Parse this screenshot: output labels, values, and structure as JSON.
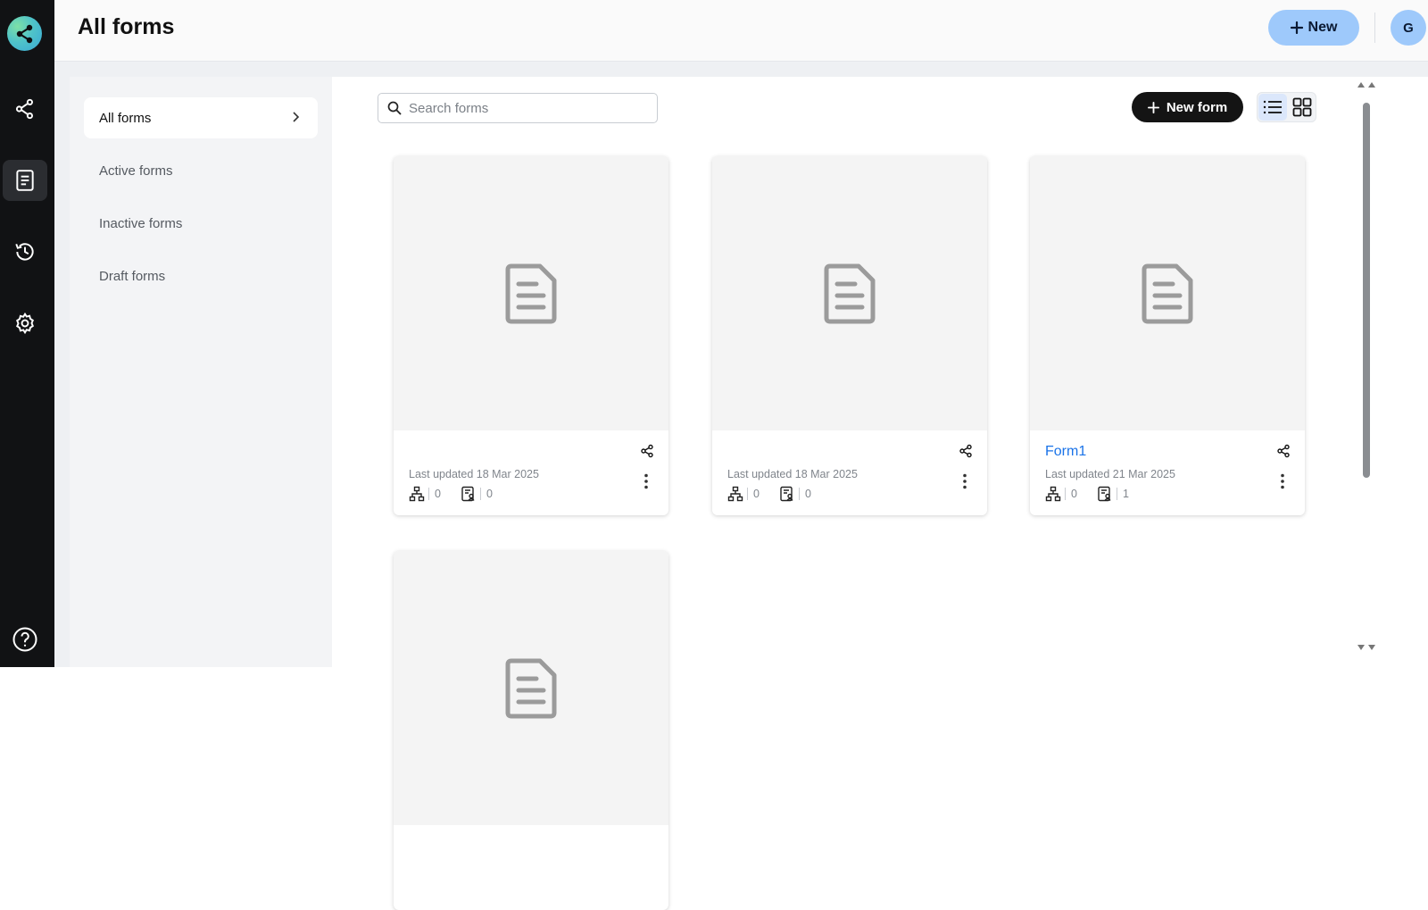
{
  "header": {
    "title": "All forms",
    "new_button": "New",
    "avatar_initial": "G"
  },
  "rail": {
    "items": [
      "workflows-icon",
      "forms-icon",
      "history-icon",
      "settings-icon",
      "help-icon"
    ],
    "active": "forms-icon"
  },
  "subnav": {
    "items": [
      {
        "label": "All forms",
        "active": true
      },
      {
        "label": "Active forms",
        "active": false
      },
      {
        "label": "Inactive forms",
        "active": false
      },
      {
        "label": "Draft forms",
        "active": false
      }
    ]
  },
  "toolbar": {
    "search_placeholder": "Search forms",
    "new_form_label": "New form",
    "view_modes": [
      "list",
      "grid"
    ],
    "active_view": "grid"
  },
  "cards": [
    {
      "name": "",
      "updated": "Last updated 18 Mar 2025",
      "workflows": "0",
      "responses": "0"
    },
    {
      "name": "",
      "updated": "Last updated 18 Mar 2025",
      "workflows": "0",
      "responses": "0"
    },
    {
      "name": "Form1",
      "updated": "Last updated 21 Mar 2025",
      "workflows": "0",
      "responses": "1"
    },
    {
      "name": "",
      "updated": "",
      "workflows": "",
      "responses": ""
    }
  ],
  "colors": {
    "rail_bg": "#111214",
    "accent_light_blue": "#9ec9fb",
    "link_blue": "#1a73e8",
    "dark_button": "#141414"
  }
}
